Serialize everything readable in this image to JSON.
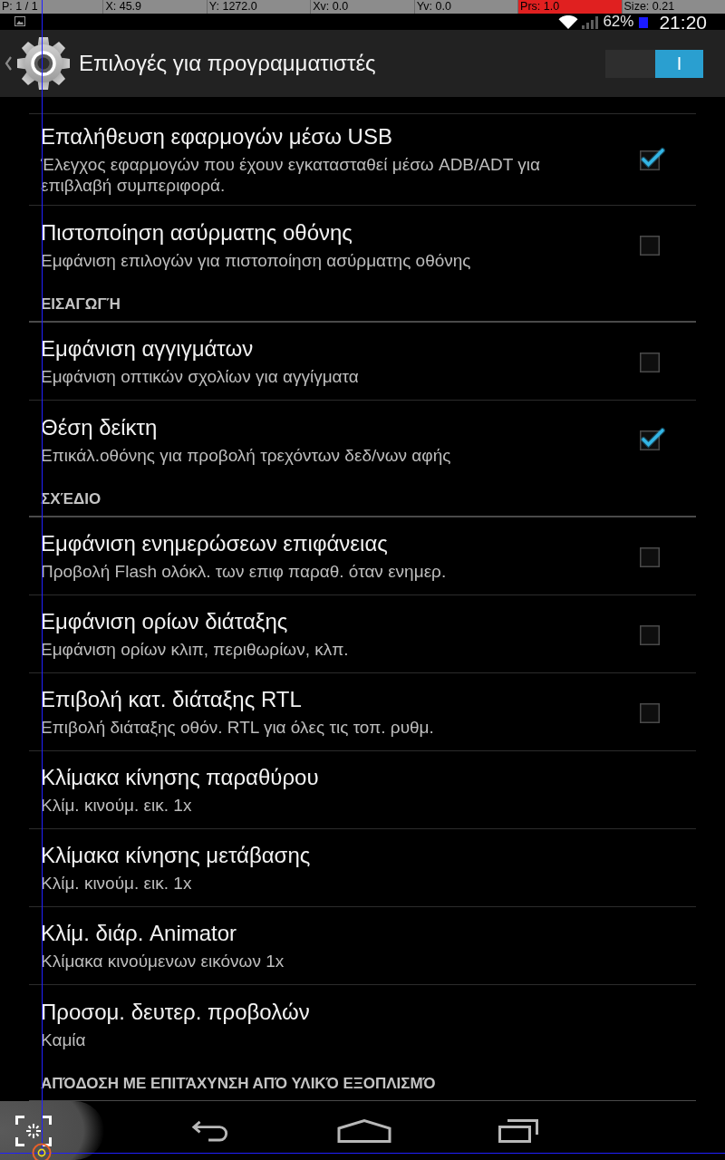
{
  "pointer_overlay": {
    "readouts": [
      {
        "text": "P: 1 / 1",
        "highlight": false
      },
      {
        "text": "X: 45.9",
        "highlight": false
      },
      {
        "text": "Y: 1272.0",
        "highlight": false
      },
      {
        "text": "Xv: 0.0",
        "highlight": false
      },
      {
        "text": "Yv: 0.0",
        "highlight": false
      },
      {
        "text": "Prs: 1.0",
        "highlight": true
      },
      {
        "text": "Size: 0.21",
        "highlight": false
      }
    ]
  },
  "status_bar": {
    "battery": "62%",
    "time": "21:20"
  },
  "action_bar": {
    "title": "Επιλογές για προγραμματιστές",
    "switch": {
      "on": true,
      "label": "I"
    }
  },
  "list": [
    {
      "kind": "checkbox",
      "title": "Επαλήθευση εφαρμογών μέσω USB",
      "summary": "Έλεγχος εφαρμογών που έχουν εγκατασταθεί μέσω ADB/ADT για επιβλαβή συμπεριφορά.",
      "checked": true
    },
    {
      "kind": "checkbox",
      "title": "Πιστοποίηση ασύρματης οθόνης",
      "summary": "Εμφάνιση επιλογών για πιστοποίηση ασύρματης οθόνης",
      "checked": false
    },
    {
      "kind": "header",
      "title": "ΕΙΣΑΓΩΓΉ"
    },
    {
      "kind": "checkbox",
      "title": "Εμφάνιση αγγιγμάτων",
      "summary": "Εμφάνιση οπτικών σχολίων για αγγίγματα",
      "checked": false
    },
    {
      "kind": "checkbox",
      "title": "Θέση δείκτη",
      "summary": "Επικάλ.οθόνης για προβολή τρεχόντων δεδ/νων αφής",
      "checked": true
    },
    {
      "kind": "header",
      "title": "ΣΧΈΔΙΟ"
    },
    {
      "kind": "checkbox",
      "title": "Εμφάνιση ενημερώσεων επιφάνειας",
      "summary": "Προβολή Flash ολόκλ. των επιφ παραθ. όταν ενημερ.",
      "checked": false
    },
    {
      "kind": "checkbox",
      "title": "Εμφάνιση ορίων διάταξης",
      "summary": "Εμφάνιση ορίων κλιπ, περιθωρίων, κλπ.",
      "checked": false
    },
    {
      "kind": "checkbox",
      "title": "Επιβολή κατ. διάταξης RTL",
      "summary": "Επιβολή διάταξης οθόν. RTL για όλες τις τοπ. ρυθμ.",
      "checked": false
    },
    {
      "kind": "text",
      "title": "Κλίμακα κίνησης παραθύρου",
      "summary": "Κλίμ. κινούμ. εικ. 1x"
    },
    {
      "kind": "text",
      "title": "Κλίμακα κίνησης μετάβασης",
      "summary": "Κλίμ. κινούμ. εικ. 1x"
    },
    {
      "kind": "text",
      "title": "Κλίμ. διάρ. Animator",
      "summary": "Κλίμακα κινούμενων εικόνων 1x"
    },
    {
      "kind": "text",
      "title": "Προσομ. δευτερ. προβολών",
      "summary": "Καμία"
    },
    {
      "kind": "header",
      "title": "ΑΠΌΔΟΣΗ ΜΕ ΕΠΙΤΆΧΥΝΣΗ ΑΠΌ ΥΛΙΚΌ ΕΞΟΠΛΙΣΜΌ"
    }
  ]
}
